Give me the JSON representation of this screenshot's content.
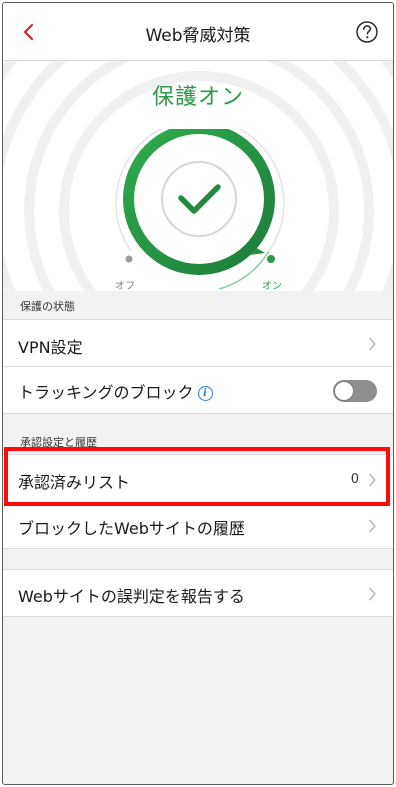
{
  "nav": {
    "title": "Web脅威対策",
    "back_icon": "chevron-left-icon",
    "help_icon": "question-circle-icon",
    "accent_color": "#d9232d"
  },
  "status": {
    "title": "保護オン",
    "off_label": "オフ",
    "on_label": "オン",
    "protection_on": true,
    "color": "#2e9a47"
  },
  "sections": {
    "protection": {
      "header": "保護の状態"
    },
    "approval": {
      "header": "承認設定と履歴"
    }
  },
  "rows": {
    "vpn": {
      "label": "VPN設定"
    },
    "tracking": {
      "label": "トラッキングのブロック",
      "toggle_on": false
    },
    "approved_list": {
      "label": "承認済みリスト",
      "count": "0"
    },
    "blocked_history": {
      "label": "ブロックしたWebサイトの履歴"
    },
    "report": {
      "label": "Webサイトの誤判定を報告する"
    }
  },
  "highlight_color": "#ff0a0a"
}
